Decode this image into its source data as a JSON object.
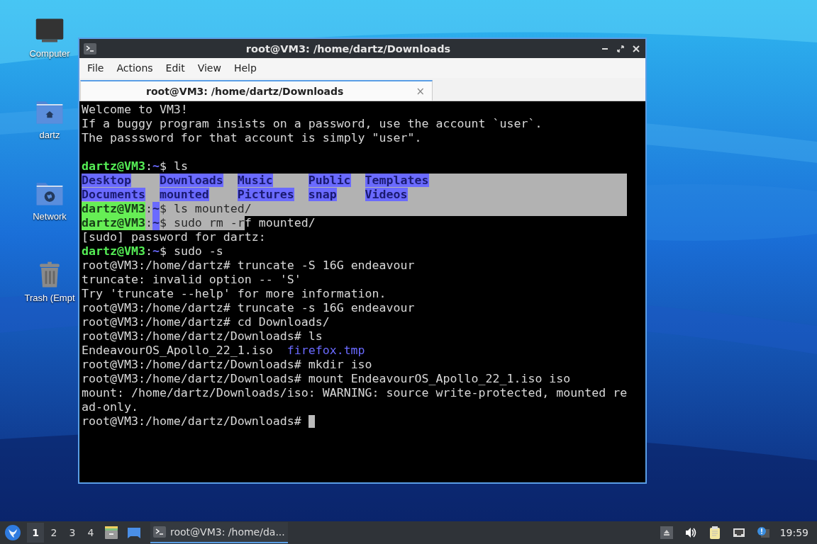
{
  "desktop": {
    "icons": [
      {
        "kind": "computer",
        "label": "Computer"
      },
      {
        "kind": "home",
        "label": "dartz"
      },
      {
        "kind": "network",
        "label": "Network"
      },
      {
        "kind": "trash",
        "label": "Trash (Empt"
      }
    ]
  },
  "window": {
    "title": "root@VM3: /home/dartz/Downloads",
    "menu": [
      "File",
      "Actions",
      "Edit",
      "View",
      "Help"
    ],
    "tabs": [
      {
        "label": "root@VM3: /home/dartz/Downloads",
        "selected": true,
        "close": "×"
      }
    ],
    "terminal": {
      "lines": [
        {
          "kind": "text",
          "selected": false,
          "segments": [
            {
              "kind": "plain",
              "text": "Welcome to VM3!",
              "selected": false
            }
          ]
        },
        {
          "kind": "text",
          "selected": false,
          "segments": [
            {
              "kind": "plain",
              "text": "If a buggy program insists on a password, use the account `user`.",
              "selected": false
            }
          ]
        },
        {
          "kind": "text",
          "selected": false,
          "segments": [
            {
              "kind": "plain",
              "text": "The passsword for that account is simply \"user\".",
              "selected": false
            }
          ]
        },
        {
          "kind": "blank"
        },
        {
          "kind": "text",
          "selected": false,
          "segments": [
            {
              "kind": "prompt",
              "text": "dartz@VM3",
              "selected": false
            },
            {
              "kind": "plain",
              "text": ":",
              "selected": false
            },
            {
              "kind": "path",
              "text": "~",
              "selected": false
            },
            {
              "kind": "plain",
              "text": "$ ls",
              "selected": false
            }
          ]
        },
        {
          "kind": "ls",
          "rows": [
            {
              "selected": true,
              "items": [
                {
                  "kind": "dir",
                  "text": "Desktop"
                },
                {
                  "kind": "dir",
                  "text": "Downloads"
                },
                {
                  "kind": "dir",
                  "text": "Music"
                },
                {
                  "kind": "dir",
                  "text": "Public"
                },
                {
                  "kind": "dir",
                  "text": "Templates"
                }
              ]
            },
            {
              "selected": true,
              "items": [
                {
                  "kind": "dir",
                  "text": "Documents"
                },
                {
                  "kind": "dir",
                  "text": "mounted"
                },
                {
                  "kind": "dir",
                  "text": "Pictures"
                },
                {
                  "kind": "dir",
                  "text": "snap"
                },
                {
                  "kind": "dir",
                  "text": "Videos"
                }
              ]
            }
          ]
        },
        {
          "kind": "text",
          "selected": true,
          "segments": [
            {
              "kind": "prompt",
              "text": "dartz@VM3",
              "selected": true
            },
            {
              "kind": "plain",
              "text": ":",
              "selected": true
            },
            {
              "kind": "path",
              "text": "~",
              "selected": true
            },
            {
              "kind": "plain",
              "text": "$ ls mounted/",
              "selected": true
            }
          ]
        },
        {
          "kind": "text",
          "selected": false,
          "segments": [
            {
              "kind": "prompt",
              "text": "dartz@VM3",
              "selected": true
            },
            {
              "kind": "plain",
              "text": ":",
              "selected": true
            },
            {
              "kind": "path",
              "text": "~",
              "selected": true
            },
            {
              "kind": "plain",
              "text": "$ sudo rm -r",
              "selected": true
            },
            {
              "kind": "plain",
              "text": "f mounted/",
              "selected": false
            }
          ]
        },
        {
          "kind": "text",
          "selected": false,
          "segments": [
            {
              "kind": "plain",
              "text": "[sudo] password for dartz:",
              "selected": false
            }
          ]
        },
        {
          "kind": "text",
          "selected": false,
          "segments": [
            {
              "kind": "prompt",
              "text": "dartz@VM3",
              "selected": false
            },
            {
              "kind": "plain",
              "text": ":",
              "selected": false
            },
            {
              "kind": "path",
              "text": "~",
              "selected": false
            },
            {
              "kind": "plain",
              "text": "$ sudo -s",
              "selected": false
            }
          ]
        },
        {
          "kind": "text",
          "selected": false,
          "segments": [
            {
              "kind": "plain",
              "text": "root@VM3:/home/dartz# truncate -S 16G endeavour",
              "selected": false
            }
          ]
        },
        {
          "kind": "text",
          "selected": false,
          "segments": [
            {
              "kind": "plain",
              "text": "truncate: invalid option -- 'S'",
              "selected": false
            }
          ]
        },
        {
          "kind": "text",
          "selected": false,
          "segments": [
            {
              "kind": "plain",
              "text": "Try 'truncate --help' for more information.",
              "selected": false
            }
          ]
        },
        {
          "kind": "text",
          "selected": false,
          "segments": [
            {
              "kind": "plain",
              "text": "root@VM3:/home/dartz# truncate -s 16G endeavour",
              "selected": false
            }
          ]
        },
        {
          "kind": "text",
          "selected": false,
          "segments": [
            {
              "kind": "plain",
              "text": "root@VM3:/home/dartz# cd Downloads/",
              "selected": false
            }
          ]
        },
        {
          "kind": "text",
          "selected": false,
          "segments": [
            {
              "kind": "plain",
              "text": "root@VM3:/home/dartz/Downloads# ls",
              "selected": false
            }
          ]
        },
        {
          "kind": "ls",
          "rows": [
            {
              "selected": false,
              "items": [
                {
                  "kind": "file",
                  "text": "EndeavourOS_Apollo_22_1.iso"
                },
                {
                  "kind": "link",
                  "text": "firefox.tmp"
                }
              ]
            }
          ]
        },
        {
          "kind": "text",
          "selected": false,
          "segments": [
            {
              "kind": "plain",
              "text": "root@VM3:/home/dartz/Downloads# mkdir iso",
              "selected": false
            }
          ]
        },
        {
          "kind": "text",
          "selected": false,
          "segments": [
            {
              "kind": "plain",
              "text": "root@VM3:/home/dartz/Downloads# mount EndeavourOS_Apollo_22_1.iso iso",
              "selected": false
            }
          ]
        },
        {
          "kind": "text",
          "selected": false,
          "segments": [
            {
              "kind": "plain",
              "text": "mount: /home/dartz/Downloads/iso: WARNING: source write-protected, mounted re",
              "selected": false
            }
          ]
        },
        {
          "kind": "text",
          "selected": false,
          "segments": [
            {
              "kind": "plain",
              "text": "ad-only.",
              "selected": false
            }
          ]
        },
        {
          "kind": "text",
          "selected": false,
          "cursor": true,
          "segments": [
            {
              "kind": "plain",
              "text": "root@VM3:/home/dartz/Downloads#",
              "selected": false
            }
          ]
        }
      ]
    }
  },
  "taskbar": {
    "workspaces": [
      {
        "label": "1",
        "selected": true
      },
      {
        "label": "2",
        "selected": false
      },
      {
        "label": "3",
        "selected": false
      },
      {
        "label": "4",
        "selected": false
      }
    ],
    "tasks": [
      {
        "label": "root@VM3: /home/da...",
        "selected": true
      }
    ],
    "clock": "19:59"
  }
}
